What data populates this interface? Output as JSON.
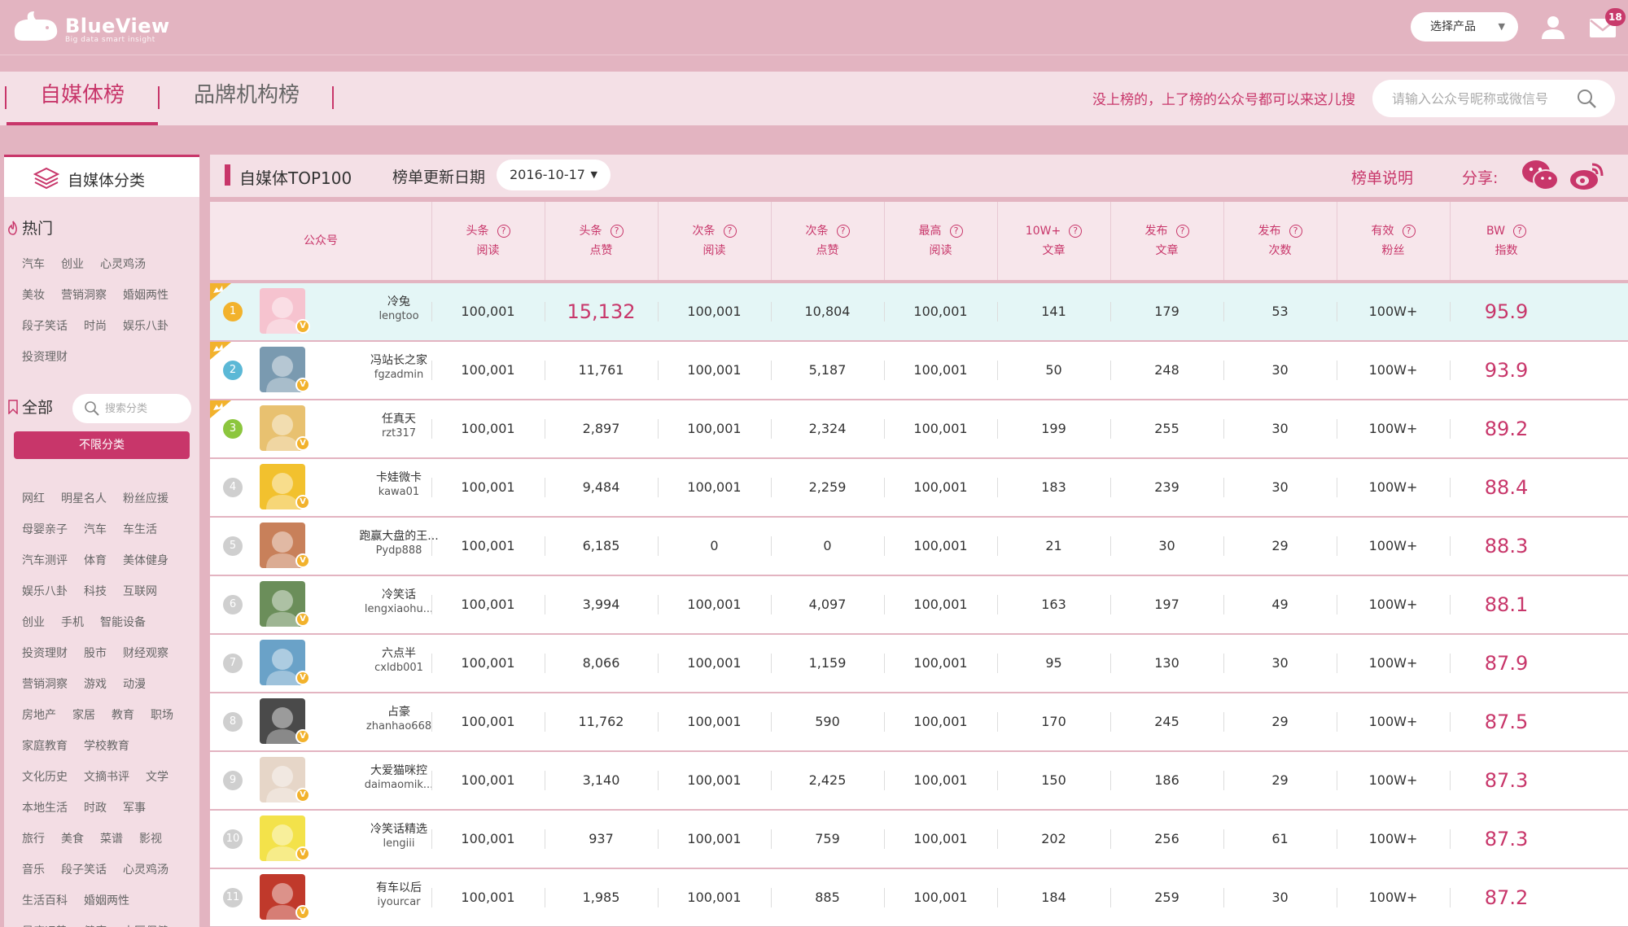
{
  "brand": {
    "name": "BlueView",
    "tagline": "Big data smart insight"
  },
  "topbar": {
    "product_select": "选择产品",
    "mail_count": "18"
  },
  "tabs": [
    {
      "label": "自媒体榜"
    },
    {
      "label": "品牌机构榜"
    }
  ],
  "notice": "没上榜的，上了榜的公众号都可以来这儿搜",
  "search": {
    "placeholder": "请输入公众号昵称或微信号"
  },
  "sidebar": {
    "title": "自媒体分类",
    "hot_label": "热门",
    "hot_tags": [
      [
        "汽车",
        "创业",
        "心灵鸡汤"
      ],
      [
        "美妆",
        "营销洞察",
        "婚姻两性"
      ],
      [
        "段子笑话",
        "时尚",
        "娱乐八卦"
      ],
      [
        "投资理财"
      ]
    ],
    "all_label": "全部",
    "cat_search_placeholder": "搜索分类",
    "unlimited_label": "不限分类",
    "all_tags": [
      [
        "网红",
        "明星名人",
        "粉丝应援"
      ],
      [
        "母婴亲子",
        "汽车",
        "车生活"
      ],
      [
        "汽车测评",
        "体育",
        "美体健身"
      ],
      [
        "娱乐八卦",
        "科技",
        "互联网"
      ],
      [
        "创业",
        "手机",
        "智能设备"
      ],
      [
        "投资理财",
        "股市",
        "财经观察"
      ],
      [
        "营销洞察",
        "游戏",
        "动漫"
      ],
      [
        "房地产",
        "家居",
        "教育",
        "职场"
      ],
      [
        "家庭教育",
        "学校教育"
      ],
      [
        "文化历史",
        "文摘书评",
        "文学"
      ],
      [
        "本地生活",
        "时政",
        "军事"
      ],
      [
        "旅行",
        "美食",
        "菜谱",
        "影视"
      ],
      [
        "音乐",
        "段子笑话",
        "心灵鸡汤"
      ],
      [
        "生活百科",
        "婚姻两性"
      ],
      [
        "星座运势",
        "健康",
        "中医保健"
      ]
    ]
  },
  "main": {
    "title": "自媒体TOP100",
    "date_label": "榜单更新日期",
    "date_value": "2016-10-17",
    "explain": "榜单说明",
    "share": "分享:"
  },
  "columns": [
    {
      "l1": "公众号",
      "l2": ""
    },
    {
      "l1": "头条",
      "l2": "阅读"
    },
    {
      "l1": "头条",
      "l2": "点赞"
    },
    {
      "l1": "次条",
      "l2": "阅读"
    },
    {
      "l1": "次条",
      "l2": "点赞"
    },
    {
      "l1": "最高",
      "l2": "阅读"
    },
    {
      "l1": "10W+",
      "l2": "文章"
    },
    {
      "l1": "发布",
      "l2": "文章"
    },
    {
      "l1": "发布",
      "l2": "次数"
    },
    {
      "l1": "有效",
      "l2": "粉丝"
    },
    {
      "l1": "BW",
      "l2": "指数"
    }
  ],
  "rows": [
    {
      "rank": "1",
      "name": "冷兔",
      "id": "lengtoo",
      "vals": [
        "100,001",
        "15,132",
        "100,001",
        "10,804",
        "100,001",
        "141",
        "179",
        "53",
        "100W+",
        "95.9"
      ]
    },
    {
      "rank": "2",
      "name": "冯站长之家",
      "id": "fgzadmin",
      "vals": [
        "100,001",
        "11,761",
        "100,001",
        "5,187",
        "100,001",
        "50",
        "248",
        "30",
        "100W+",
        "93.9"
      ]
    },
    {
      "rank": "3",
      "name": "任真天",
      "id": "rzt317",
      "vals": [
        "100,001",
        "2,897",
        "100,001",
        "2,324",
        "100,001",
        "199",
        "255",
        "30",
        "100W+",
        "89.2"
      ]
    },
    {
      "rank": "4",
      "name": "卡娃微卡",
      "id": "kawa01",
      "vals": [
        "100,001",
        "9,484",
        "100,001",
        "2,259",
        "100,001",
        "183",
        "239",
        "30",
        "100W+",
        "88.4"
      ]
    },
    {
      "rank": "5",
      "name": "跑赢大盘的王...",
      "id": "Pydp888",
      "vals": [
        "100,001",
        "6,185",
        "0",
        "0",
        "100,001",
        "21",
        "30",
        "29",
        "100W+",
        "88.3"
      ]
    },
    {
      "rank": "6",
      "name": "冷笑话",
      "id": "lengxiaohu...",
      "vals": [
        "100,001",
        "3,994",
        "100,001",
        "4,097",
        "100,001",
        "163",
        "197",
        "49",
        "100W+",
        "88.1"
      ]
    },
    {
      "rank": "7",
      "name": "六点半",
      "id": "cxldb001",
      "vals": [
        "100,001",
        "8,066",
        "100,001",
        "1,159",
        "100,001",
        "95",
        "130",
        "30",
        "100W+",
        "87.9"
      ]
    },
    {
      "rank": "8",
      "name": "占豪",
      "id": "zhanhao668",
      "vals": [
        "100,001",
        "11,762",
        "100,001",
        "590",
        "100,001",
        "170",
        "245",
        "29",
        "100W+",
        "87.5"
      ]
    },
    {
      "rank": "9",
      "name": "大爱猫咪控",
      "id": "daimaomik...",
      "vals": [
        "100,001",
        "3,140",
        "100,001",
        "2,425",
        "100,001",
        "150",
        "186",
        "29",
        "100W+",
        "87.3"
      ]
    },
    {
      "rank": "10",
      "name": "冷笑话精选",
      "id": "lengiii",
      "vals": [
        "100,001",
        "937",
        "100,001",
        "759",
        "100,001",
        "202",
        "256",
        "61",
        "100W+",
        "87.3"
      ]
    },
    {
      "rank": "11",
      "name": "有车以后",
      "id": "iyourcar",
      "vals": [
        "100,001",
        "1,985",
        "100,001",
        "885",
        "100,001",
        "184",
        "259",
        "30",
        "100W+",
        "87.2"
      ]
    }
  ],
  "colors": {
    "accent": "#c8366a",
    "bg": "#e3b4c1",
    "highlight_row": "#e4f6f6",
    "rank1": "#f2b22c",
    "rank2": "#5bb8d6",
    "rank3": "#8cc63e",
    "rank_other": "#cfcfcf"
  }
}
